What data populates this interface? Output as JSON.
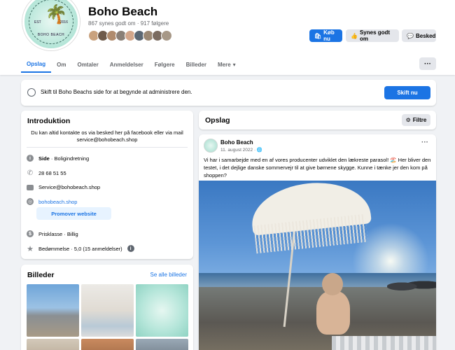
{
  "header": {
    "page_name": "Boho Beach",
    "stats": "867 synes godt om · 917 følgere",
    "logo": {
      "est": "EST",
      "year": "2016",
      "brand": "BOHO BEACH"
    },
    "buttons": {
      "buy": "Køb nu",
      "like": "Synes godt om",
      "message": "Besked"
    },
    "tabs": [
      "Opslag",
      "Om",
      "Omtaler",
      "Anmeldelser",
      "Følgere",
      "Billeder",
      "Mere"
    ],
    "more_icon": "···"
  },
  "switch_banner": {
    "text": "Skift til Boho Beachs side for at begynde at administrere den.",
    "button": "Skift nu"
  },
  "intro": {
    "title": "Introduktion",
    "description": "Du kan altid kontakte os via besked her på facebook eller via mail service@bohobeach.shop",
    "page_label": "Side",
    "page_category": " · Boligindretning",
    "phone": "28 68 51 55",
    "email": "Service@bohobeach.shop",
    "website": "bohobeach.shop",
    "promote_button": "Promover website",
    "price": "Prisklasse · Billig",
    "rating": "Bedømmelse · 5,0 (15 anmeldelser)"
  },
  "photos": {
    "title": "Billeder",
    "see_all": "Se alle billeder"
  },
  "posts": {
    "title": "Opslag",
    "filter": "Filtre"
  },
  "post": {
    "author": "Boho Beach",
    "date": "11. august 2022 · ",
    "menu": "···",
    "text": "Vi har i samarbejde med en af vores producenter udviklet den lækreste parasol! 🏖️ Her bliver den testet, i det dejlige danske sommervejr til at give børnene skygge. Kunne i tænke jer den kom på shoppen?"
  },
  "icons": {
    "search": "search-icon",
    "colors": {
      "accent": "#1b74e4",
      "background": "#f0f2f5",
      "secondary_text": "#65676b"
    }
  }
}
